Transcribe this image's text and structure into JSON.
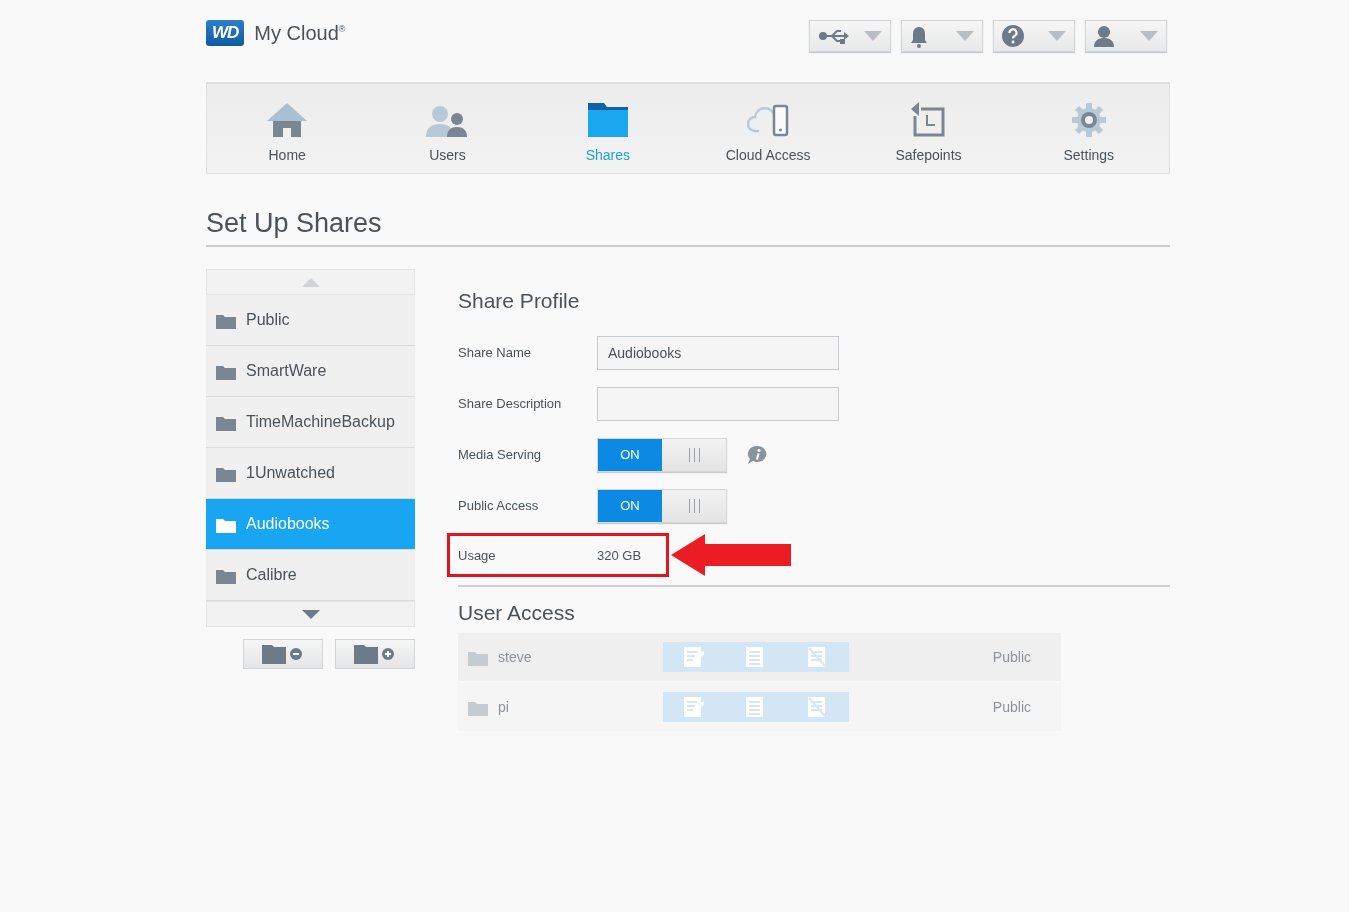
{
  "header": {
    "logo": "WD",
    "product": "My Cloud",
    "product_mark": "®"
  },
  "nav": [
    {
      "label": "Home",
      "selected": false
    },
    {
      "label": "Users",
      "selected": false
    },
    {
      "label": "Shares",
      "selected": true
    },
    {
      "label": "Cloud Access",
      "selected": false
    },
    {
      "label": "Safepoints",
      "selected": false
    },
    {
      "label": "Settings",
      "selected": false
    }
  ],
  "page_title": "Set Up Shares",
  "shares": [
    {
      "name": "Public",
      "selected": false
    },
    {
      "name": "SmartWare",
      "selected": false
    },
    {
      "name": "TimeMachineBackup",
      "selected": false
    },
    {
      "name": "1Unwatched",
      "selected": false
    },
    {
      "name": "Audiobooks",
      "selected": true
    },
    {
      "name": "Calibre",
      "selected": false
    }
  ],
  "share_profile": {
    "title": "Share Profile",
    "fields": [
      {
        "label": "Share Name",
        "value": "Audiobooks"
      },
      {
        "label": "Share Description"
      }
    ],
    "toggles": [
      {
        "label": "Media Serving",
        "on": true,
        "text": "ON",
        "info": true
      },
      {
        "label": "Public Access",
        "on": true,
        "text": "ON",
        "info": false
      }
    ],
    "usage": {
      "label": "Usage",
      "value": "320 GB",
      "highlighted": true
    }
  },
  "user_access": {
    "title": "User Access",
    "disabled": true,
    "rows": [
      {
        "name": "steve",
        "access": "Public"
      },
      {
        "name": "pi",
        "access": "Public"
      }
    ]
  }
}
